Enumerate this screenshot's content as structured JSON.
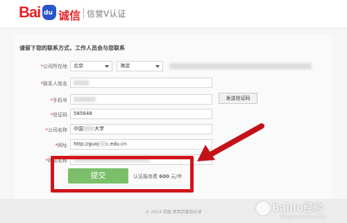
{
  "header": {
    "logo_text": "Bai",
    "logo_paw_text": "du",
    "logo_brand": "诚信",
    "product": "信誉V认证"
  },
  "form": {
    "intro": "请留下您的联系方式，工作人员会与您联系",
    "fields": {
      "company_location": {
        "label": "公司所在地",
        "province": "北京",
        "district": "海淀"
      },
      "contact_name": {
        "label": "联系人姓名"
      },
      "phone": {
        "label": "手机号"
      },
      "verify_code": {
        "label": "验证码",
        "value": "585648"
      },
      "company_name": {
        "label": "公司名称",
        "value_prefix": "中国",
        "value_suffix": "大学"
      },
      "website": {
        "label": "网址",
        "value_prefix": "http://guoj",
        "value_suffix": "c.edu.cn"
      },
      "website_name": {
        "label": "网站名称"
      }
    },
    "send_code_label": "发送验证码",
    "submit_label": "提交",
    "fee_prefix": "认证服务费 ",
    "fee_amount": "600",
    "fee_suffix": " 元/年"
  },
  "footer": {
    "copyright": "© 2014 百度 使用百度前必读"
  },
  "watermark": {
    "brand": "Baidu经验",
    "url": "jingyan.baidu.com"
  },
  "colors": {
    "brand_red": "#e52226",
    "submit_green": "#7bbf6a",
    "highlight_red": "#d0151b",
    "logo_blue": "#2b55c8"
  }
}
